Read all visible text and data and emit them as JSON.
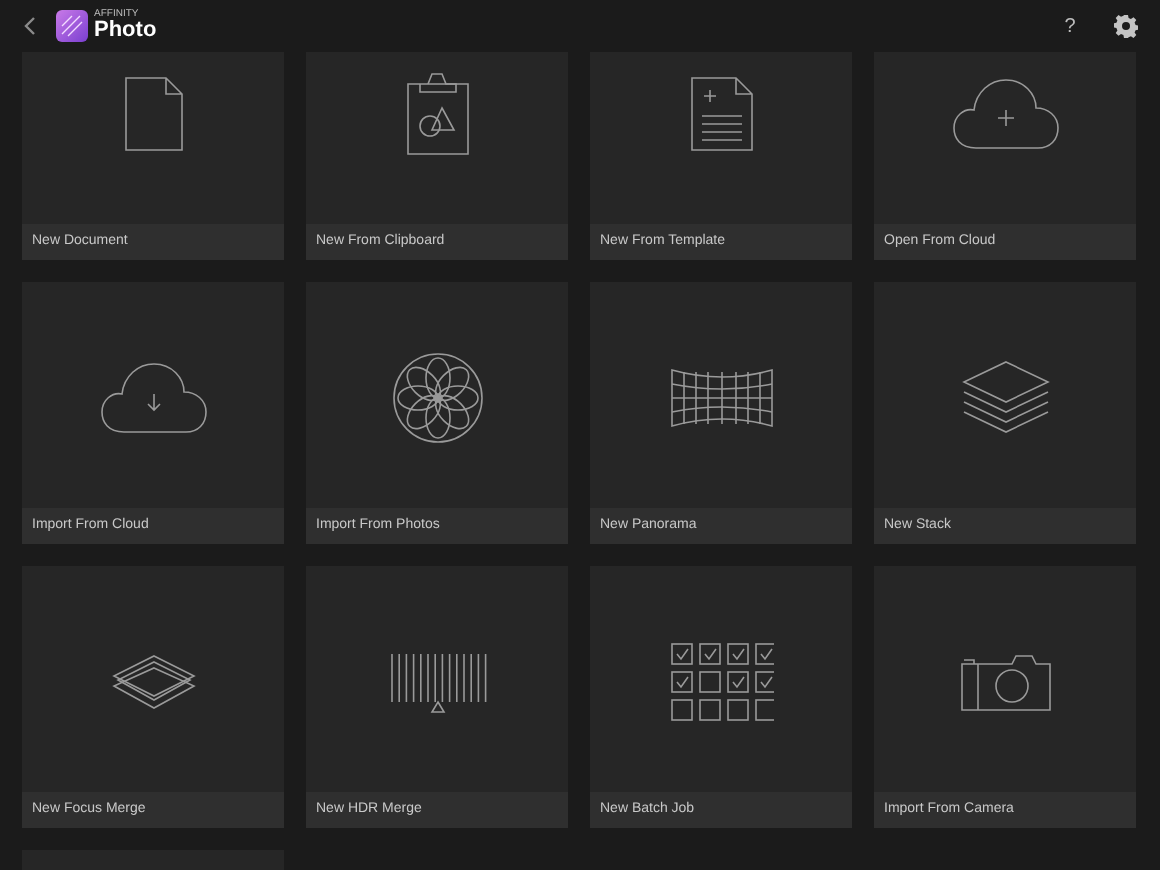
{
  "header": {
    "brand_small": "AFFINITY",
    "brand": "Photo",
    "help": "?"
  },
  "tiles": [
    {
      "kind": "document",
      "label": "New Document"
    },
    {
      "kind": "clipboard",
      "label": "New From Clipboard"
    },
    {
      "kind": "template",
      "label": "New From Template"
    },
    {
      "kind": "cloud_open",
      "label": "Open From Cloud"
    },
    {
      "kind": "cloud_import",
      "label": "Import From Cloud"
    },
    {
      "kind": "photos",
      "label": "Import From Photos"
    },
    {
      "kind": "panorama",
      "label": "New Panorama"
    },
    {
      "kind": "stack",
      "label": "New Stack"
    },
    {
      "kind": "focus",
      "label": "New Focus Merge"
    },
    {
      "kind": "hdr",
      "label": "New HDR Merge"
    },
    {
      "kind": "batch",
      "label": "New Batch Job"
    },
    {
      "kind": "camera",
      "label": "Import From Camera"
    },
    {
      "kind": "blank"
    }
  ]
}
